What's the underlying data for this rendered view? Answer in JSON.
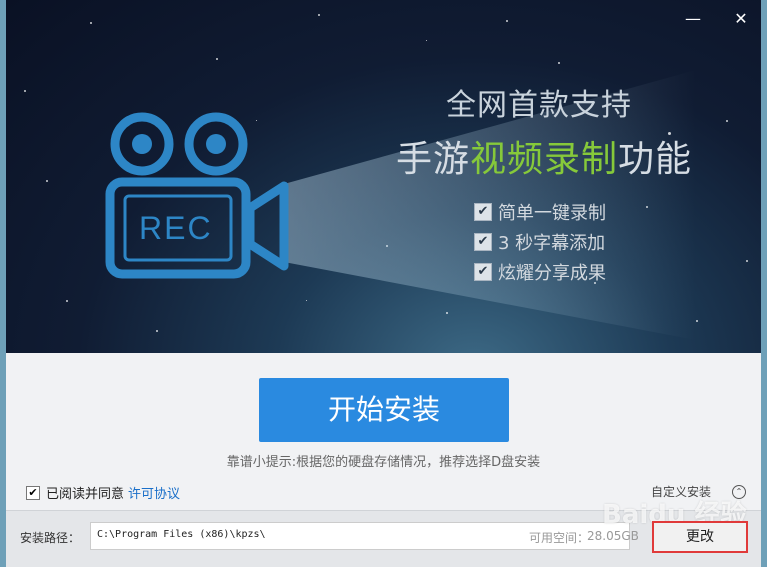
{
  "window": {
    "minimize_glyph": "—",
    "close_glyph": "✕"
  },
  "banner": {
    "camera_label": "REC",
    "headline_line1": "全网首款支持",
    "headline_line2_pre": "手游",
    "headline_line2_highlight": "视频录制",
    "headline_line2_post": "功能",
    "highlight_color": "#86c93a",
    "features": [
      {
        "label": "简单一键录制",
        "checked": true
      },
      {
        "label": "3 秒字幕添加",
        "checked": true
      },
      {
        "label": "炫耀分享成果",
        "checked": true
      }
    ],
    "check_glyph": "✔"
  },
  "install": {
    "button_label": "开始安装",
    "button_color": "#2a8ae0",
    "tip": "靠谱小提示:根据您的硬盘存储情况，推荐选择D盘安装"
  },
  "agreement": {
    "label": "已阅读并同意",
    "link": "许可协议",
    "checked": true
  },
  "custom_install": {
    "label": "自定义安装",
    "icon_glyph": "⌃"
  },
  "path": {
    "label": "安装路径：",
    "value": "C:\\Program Files (x86)\\kpzs\\",
    "space_label": "可用空间：",
    "space_value": "28.05GB",
    "change_label": "更改",
    "highlight_color": "#e03a3a"
  },
  "watermark": {
    "text": "Baidu 经验"
  }
}
